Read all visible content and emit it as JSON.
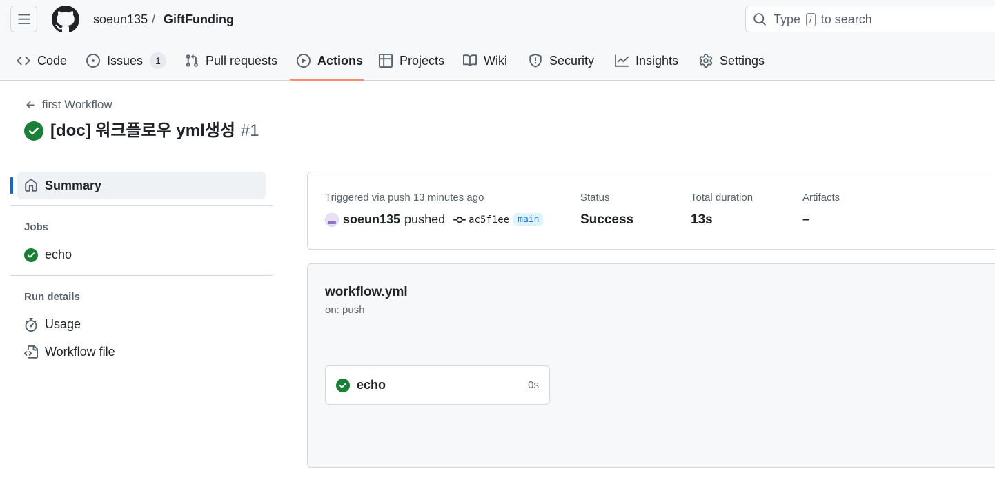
{
  "header": {
    "owner": "soeun135",
    "separator": "/",
    "repo": "GiftFunding",
    "search_prefix": "Type",
    "search_key": "/",
    "search_suffix": "to search"
  },
  "tabs": [
    {
      "label": "Code",
      "icon": "code-icon"
    },
    {
      "label": "Issues",
      "icon": "issue-opened-icon",
      "count": "1"
    },
    {
      "label": "Pull requests",
      "icon": "git-pull-request-icon"
    },
    {
      "label": "Actions",
      "icon": "play-icon",
      "active": true
    },
    {
      "label": "Projects",
      "icon": "table-icon"
    },
    {
      "label": "Wiki",
      "icon": "book-icon"
    },
    {
      "label": "Security",
      "icon": "shield-icon"
    },
    {
      "label": "Insights",
      "icon": "graph-icon"
    },
    {
      "label": "Settings",
      "icon": "gear-icon"
    }
  ],
  "run": {
    "back_label": "first Workflow",
    "title": "[doc] 워크플로우 yml생성",
    "number": "#1"
  },
  "sidebar": {
    "summary_label": "Summary",
    "jobs_heading": "Jobs",
    "jobs": [
      {
        "label": "echo",
        "status": "success"
      }
    ],
    "details_heading": "Run details",
    "details": [
      {
        "label": "Usage",
        "icon": "stopwatch-icon"
      },
      {
        "label": "Workflow file",
        "icon": "file-code-icon"
      }
    ]
  },
  "summary": {
    "trigger_label": "Triggered via push 13 minutes ago",
    "actor": "soeun135",
    "action": "pushed",
    "commit": "ac5f1ee",
    "branch": "main",
    "status_label": "Status",
    "status_value": "Success",
    "duration_label": "Total duration",
    "duration_value": "13s",
    "artifacts_label": "Artifacts",
    "artifacts_value": "–"
  },
  "graph": {
    "workflow_file": "workflow.yml",
    "trigger": "on: push",
    "job": {
      "name": "echo",
      "duration": "0s"
    }
  },
  "colors": {
    "success": "#1a7f37",
    "accent": "#0969da",
    "tab_underline": "#fd8c73"
  }
}
